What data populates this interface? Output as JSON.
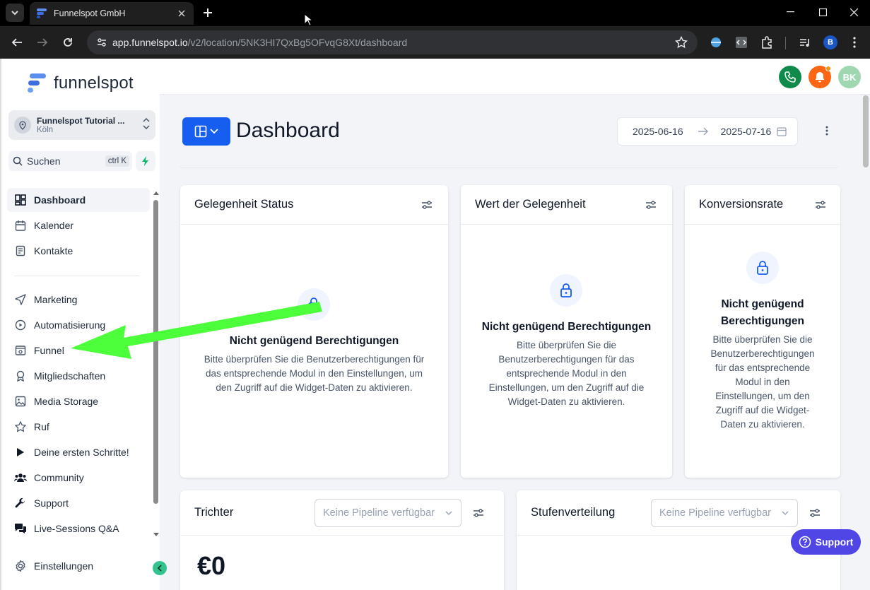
{
  "browser": {
    "tab_title": "Funnelspot GmbH",
    "url_host": "app.funnelspot.io",
    "url_path": "/v2/location/5NK3HI7QxBg5OFvqG8Xt/dashboard",
    "profile_initial": "B"
  },
  "sidebar": {
    "brand": "funnelspot",
    "location_name": "Funnelspot Tutorial ...",
    "location_city": "Köln",
    "search_label": "Suchen",
    "search_shortcut": "ctrl K",
    "items": [
      {
        "label": "Dashboard",
        "icon": "dashboard-icon",
        "active": true
      },
      {
        "label": "Kalender",
        "icon": "calendar-icon"
      },
      {
        "label": "Kontakte",
        "icon": "contacts-icon"
      },
      {
        "label": "Marketing",
        "icon": "send-icon"
      },
      {
        "label": "Automatisierung",
        "icon": "automation-icon"
      },
      {
        "label": "Funnel",
        "icon": "funnel-icon"
      },
      {
        "label": "Mitgliedschaften",
        "icon": "badge-icon"
      },
      {
        "label": "Media Storage",
        "icon": "image-icon"
      },
      {
        "label": "Ruf",
        "icon": "star-icon"
      },
      {
        "label": "Deine ersten Schritte!",
        "icon": "play-icon"
      },
      {
        "label": "Community",
        "icon": "users-icon"
      },
      {
        "label": "Support",
        "icon": "wrench-icon"
      },
      {
        "label": "Live-Sessions Q&A",
        "icon": "chat-icon"
      }
    ],
    "settings_label": "Einstellungen"
  },
  "header": {
    "avatar_initials": "BK"
  },
  "dashboard": {
    "title": "Dashboard",
    "date_from": "2025-06-16",
    "date_to": "2025-07-16"
  },
  "widgets": {
    "w1": {
      "title": "Gelegenheit Status"
    },
    "w2": {
      "title": "Wert der Gelegenheit"
    },
    "w3": {
      "title": "Konversionsrate"
    },
    "w4": {
      "title": "Trichter",
      "select_placeholder": "Keine Pipeline verfügbar",
      "value": "€0"
    },
    "w5": {
      "title": "Stufenverteilung",
      "select_placeholder": "Keine Pipeline verfügbar"
    }
  },
  "permission": {
    "title": "Nicht genügend Berechtigungen",
    "body": "Bitte überprüfen Sie die Benutzerberechtigungen für das entsprechende Modul in den Einstellungen, um den Zugriff auf die Widget-Daten zu aktivieren."
  },
  "support_widget": {
    "label": "Support"
  },
  "colors": {
    "primary": "#155eef",
    "annotation_arrow": "#4cff3a",
    "support": "#4f46e5",
    "call": "#0f8a4b",
    "notify": "#fb6514"
  }
}
